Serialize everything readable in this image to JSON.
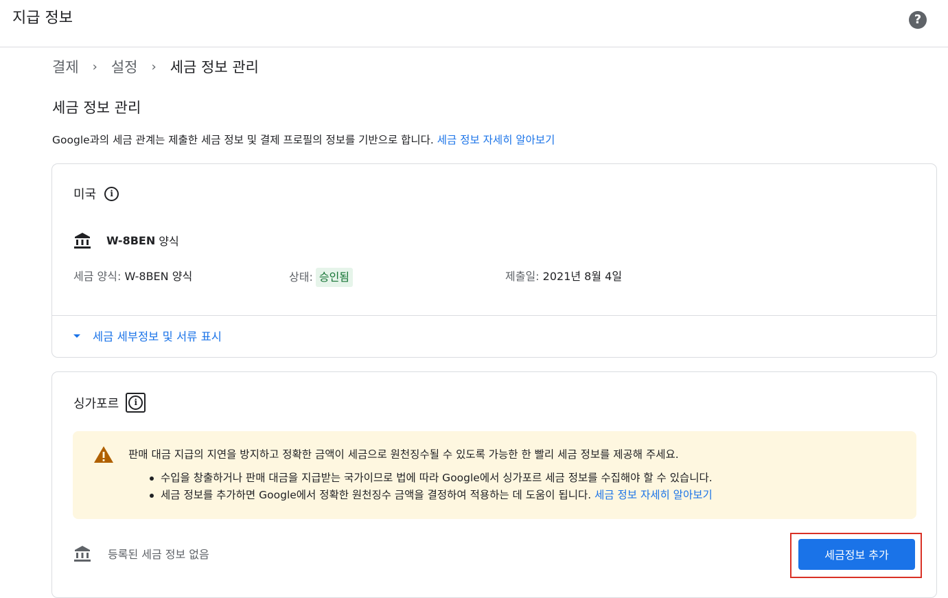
{
  "header": {
    "title": "지급 정보",
    "help_glyph": "?"
  },
  "breadcrumb": {
    "items": [
      "결제",
      "설정",
      "세금 정보 관리"
    ],
    "separator": "›"
  },
  "page": {
    "title": "세금 정보 관리",
    "intro_text": "Google과의 세금 관계는 제출한 세금 정보 및 결제 프로필의 정보를 기반으로 합니다. ",
    "intro_link": "세금 정보 자세히 알아보기"
  },
  "us_card": {
    "country": "미국",
    "form_name": "W-8BEN",
    "form_suffix": "양식",
    "tax_form_label": "세금 양식:",
    "tax_form_value": "W-8BEN 양식",
    "status_label": "상태:",
    "status_value": "승인됨",
    "submitted_label": "제출일:",
    "submitted_value": "2021년 8월 4일",
    "expand_label": "세금 세부정보 및 서류 표시"
  },
  "sg_card": {
    "country": "싱가포르",
    "warning_main": "판매 대금 지급의 지연을 방지하고 정확한 금액이 세금으로 원천징수될 수 있도록 가능한 한 빨리 세금 정보를 제공해 주세요.",
    "warning_bullet_1": "수입을 창출하거나 판매 대금을 지급받는 국가이므로 법에 따라 Google에서 싱가포르 세금 정보를 수집해야 할 수 있습니다.",
    "warning_bullet_2_text": "세금 정보를 추가하면 Google에서 정확한 원천징수 금액을 결정하여 적용하는 데 도움이 됩니다. ",
    "warning_bullet_2_link": "세금 정보 자세히 알아보기",
    "empty_text": "등록된 세금 정보 없음",
    "add_button_label": "세금정보 추가"
  },
  "icons": {
    "help": "help-circle-icon",
    "info": "info-circle-icon",
    "bank": "bank-building-icon",
    "warning": "warning-triangle-icon",
    "caret": "caret-down-icon"
  },
  "colors": {
    "accent": "#1a73e8",
    "status_bg": "#e6f4ea",
    "status_text": "#137333",
    "warning_bg": "#fef7e0",
    "warning_icon": "#b06000",
    "highlight_outline": "#d93025"
  }
}
